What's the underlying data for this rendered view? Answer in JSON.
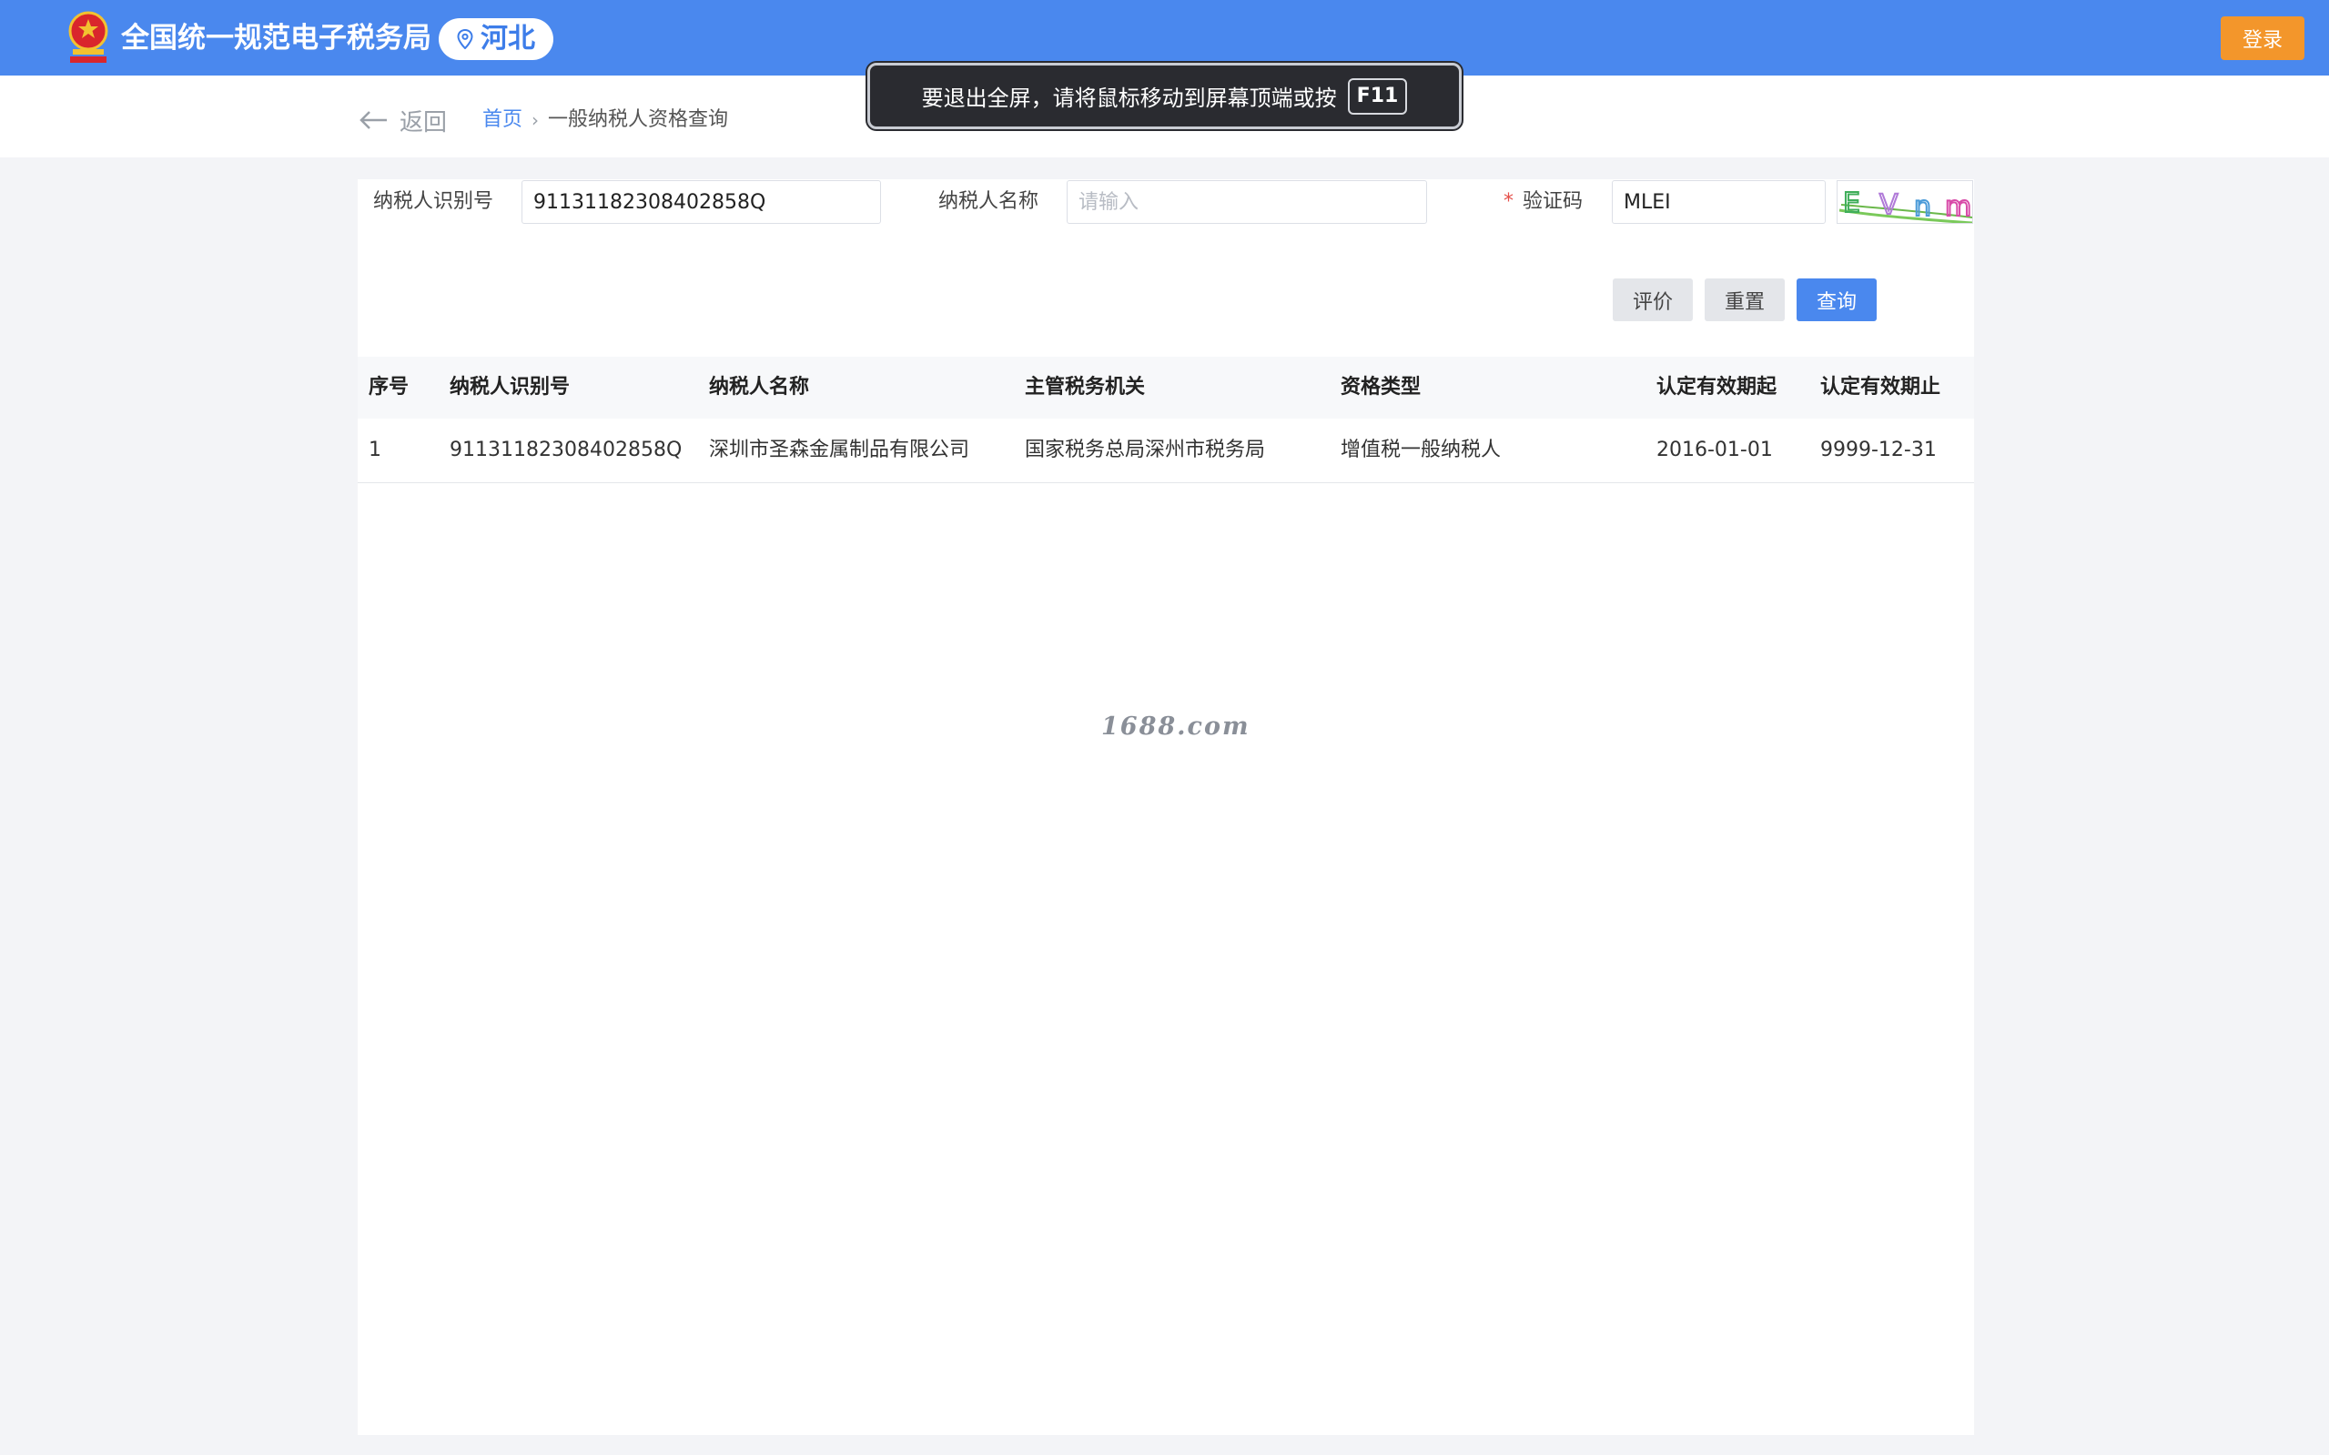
{
  "header": {
    "site_title": "全国统一规范电子税务局",
    "region": "河北",
    "login_label": "登录"
  },
  "nav": {
    "back_label": "返回",
    "breadcrumb": {
      "home": "首页",
      "separator": "›",
      "current": "一般纳税人资格查询"
    }
  },
  "toast": {
    "message": "要退出全屏，请将鼠标移动到屏幕顶端或按",
    "key": "F11"
  },
  "form": {
    "taxpayer_id": {
      "label": "纳税人识别号",
      "value": "91131182308402858Q"
    },
    "taxpayer_name": {
      "label": "纳税人名称",
      "value": "",
      "placeholder": "请输入"
    },
    "captcha": {
      "required_mark": "*",
      "label": "验证码",
      "value": "MLEI"
    },
    "buttons": {
      "evaluate": "评价",
      "reset": "重置",
      "query": "查询"
    }
  },
  "table": {
    "columns": [
      "序号",
      "纳税人识别号",
      "纳税人名称",
      "主管税务机关",
      "资格类型",
      "认定有效期起",
      "认定有效期止"
    ],
    "rows": [
      [
        "1",
        "91131182308402858Q",
        "深圳市圣森金属制品有限公司",
        "国家税务总局深州市税务局",
        "增值税一般纳税人",
        "2016-01-01",
        "9999-12-31"
      ]
    ]
  },
  "watermark": "1688.com",
  "colors": {
    "header_bg": "#4a88ee",
    "login_bg": "#f3962b",
    "primary": "#4a88ee",
    "required": "#e5504a"
  },
  "icons": {
    "emblem": "national-emblem-icon",
    "pin": "location-pin-icon",
    "back": "arrow-left-icon"
  }
}
